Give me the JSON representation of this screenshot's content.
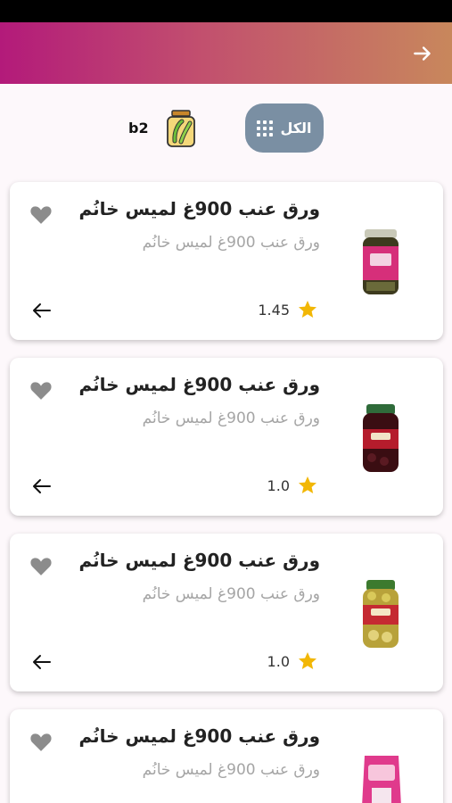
{
  "categories": [
    {
      "label": "الكل",
      "icon": "grid-icon",
      "selected": true,
      "color": "#7a8fa3"
    },
    {
      "label": "b2",
      "icon": "pickle-jar-icon",
      "selected": false
    }
  ],
  "products": [
    {
      "title": "ورق عنب 900غ لميس خانُم",
      "subtitle": "ورق عنب 900غ لميس خانُم",
      "rating": "1.45",
      "image": "jar-pink-label"
    },
    {
      "title": "ورق عنب 900غ لميس خانُم",
      "subtitle": "ورق عنب 900غ لميس خانُم",
      "rating": "1.0",
      "image": "jar-dark-olives"
    },
    {
      "title": "ورق عنب 900غ لميس خانُم",
      "subtitle": "ورق عنب 900غ لميس خانُم",
      "rating": "1.0",
      "image": "jar-green-olives"
    },
    {
      "title": "ورق عنب 900غ لميس خانُم",
      "subtitle": "ورق عنب 900غ لميس خانُم",
      "rating": "",
      "image": "bag-pink"
    }
  ],
  "colors": {
    "app_bar_start": "#b31a7a",
    "app_bar_end": "#c8875c",
    "star": "#f2b705",
    "heart": "#8c8c8c"
  }
}
